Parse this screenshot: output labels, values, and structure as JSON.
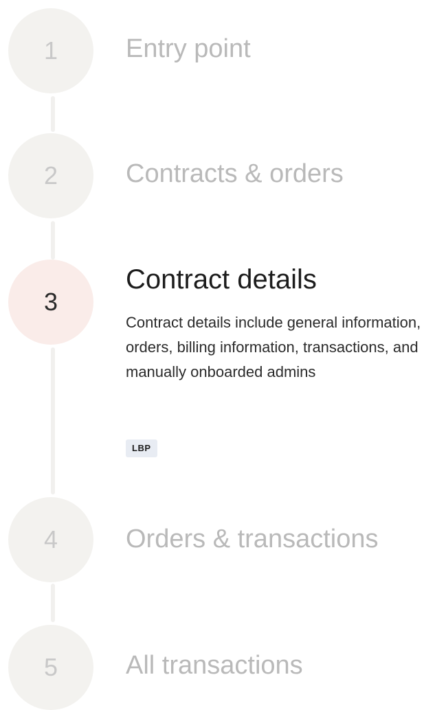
{
  "steps": [
    {
      "number": "1",
      "title": "Entry point",
      "active": false
    },
    {
      "number": "2",
      "title": "Contracts & orders",
      "active": false
    },
    {
      "number": "3",
      "title": "Contract details",
      "active": true,
      "description": "Contract details include general information, orders, billing information, transactions, and manually onboarded admins",
      "badge": "LBP"
    },
    {
      "number": "4",
      "title": "Orders & transactions",
      "active": false
    },
    {
      "number": "5",
      "title": "All transactions",
      "active": false
    }
  ],
  "colors": {
    "inactive_circle": "#f3f2ef",
    "active_circle": "#faece9",
    "inactive_text": "#b9b9b9",
    "active_text": "#1c1c1c",
    "connector": "#f1f0ee",
    "badge_bg": "#e8ecf3"
  }
}
